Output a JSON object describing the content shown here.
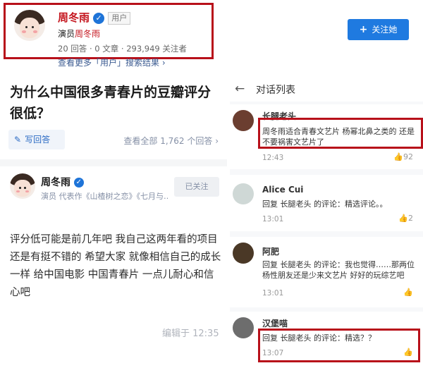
{
  "profile": {
    "name": "周冬雨",
    "tag": "用户",
    "role_prefix": "演员",
    "role_name": "周冬雨",
    "stats": "20 回答 · 0 文章 · 293,949 关注者"
  },
  "follow_button": {
    "icon": "+",
    "label": "关注她"
  },
  "more_results": "查看更多「用户」搜索结果 ›",
  "question": {
    "title": "为什么中国很多青春片的豆瓣评分很低？",
    "write_answer": "写回答",
    "view_all": "查看全部 1,762 个回答 ›"
  },
  "answer": {
    "author": "周冬雨",
    "description": "演员 代表作《山楂树之恋》《七月与…",
    "followed_label": "已关注",
    "body": "评分低可能是前几年吧 我自己这两年看的项目还是有挺不错的 希望大家 就像相信自己的成长一样 给中国电影 中国青春片 一点儿耐心和信心吧",
    "edited": "编辑于 12:35"
  },
  "dialog": {
    "title": "对话列表",
    "comments": [
      {
        "name": "长腿老头",
        "text": "周冬雨适合青春文艺片 杨幂北鼻之类的 还是不要祸害文艺片了",
        "time": "12:43",
        "likes": "92",
        "avatar_color": "#6b3e30"
      },
      {
        "name": "Alice Cui",
        "text": "回复 长腿老头 的评论：精选评论。。",
        "time": "13:01",
        "likes": "2",
        "avatar_color": "#cfd8d6"
      },
      {
        "name": "阿肥",
        "text": "回复 长腿老头 的评论：我也觉得……那两位杨性朋友还是少来文艺片 好好的玩综艺吧",
        "time": "13:01",
        "likes": "",
        "avatar_color": "#4a3826"
      },
      {
        "name": "汉堡喵",
        "text": "回复 长腿老头 的评论：精选？？",
        "time": "13:07",
        "likes": "",
        "avatar_color": "#6d6d6d"
      }
    ]
  },
  "colors": {
    "highlight": "#b8101a",
    "brand_blue": "#1f7ae0",
    "name_red": "#c4141d"
  }
}
